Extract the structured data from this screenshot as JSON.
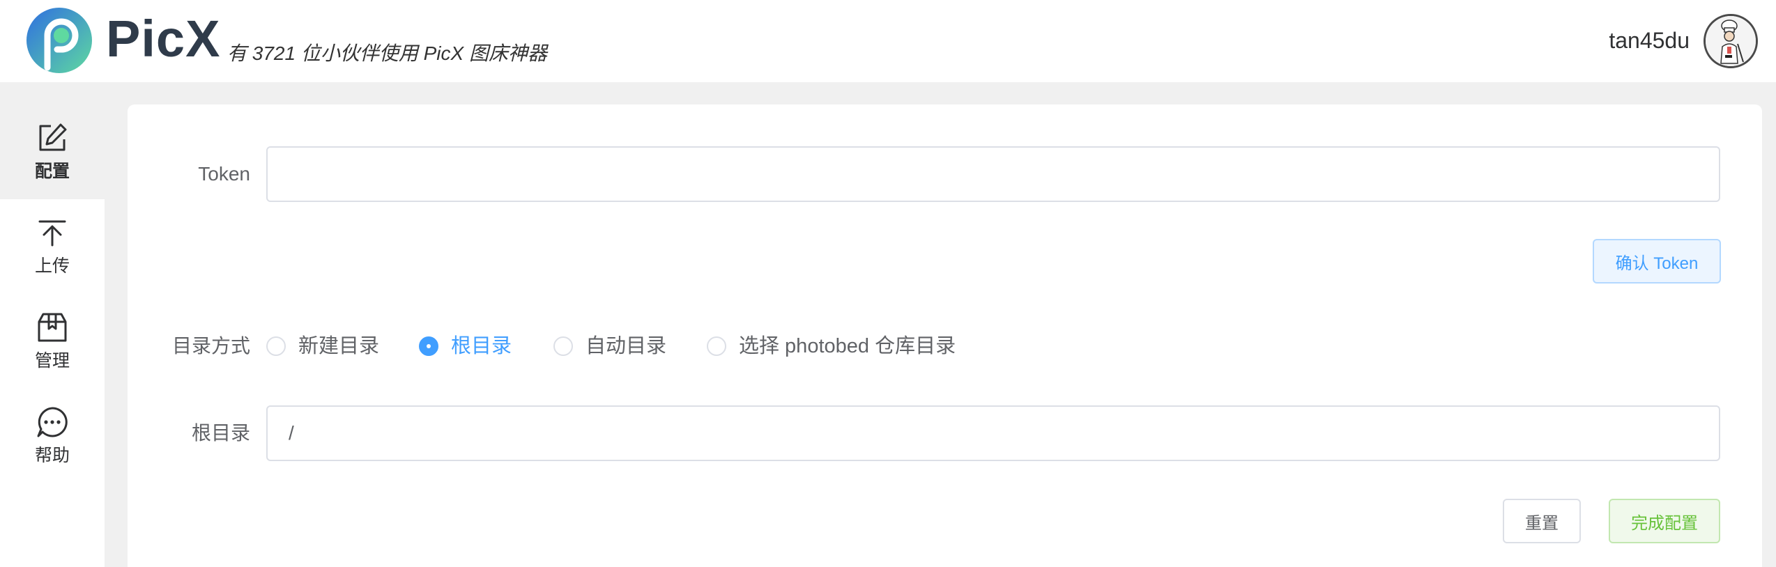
{
  "header": {
    "brand": "PicX",
    "tagline": "有 3721 位小伙伴使用 PicX 图床神器",
    "username": "tan45du"
  },
  "sidebar": {
    "items": [
      {
        "label": "配置",
        "icon": "edit-icon",
        "active": true
      },
      {
        "label": "上传",
        "icon": "upload-icon",
        "active": false
      },
      {
        "label": "管理",
        "icon": "box-icon",
        "active": false
      },
      {
        "label": "帮助",
        "icon": "chat-icon",
        "active": false
      }
    ]
  },
  "form": {
    "token_label": "Token",
    "token_value": "",
    "confirm_token_button": "确认 Token",
    "dir_mode_label": "目录方式",
    "dir_options": [
      {
        "label": "新建目录",
        "checked": false
      },
      {
        "label": "根目录",
        "checked": true
      },
      {
        "label": "自动目录",
        "checked": false
      },
      {
        "label": "选择 photobed 仓库目录",
        "checked": false
      }
    ],
    "root_dir_label": "根目录",
    "root_dir_value": "/",
    "reset_button": "重置",
    "finish_button": "完成配置"
  },
  "colors": {
    "primary": "#409eff",
    "success": "#67c23a",
    "brand_dark": "#2f3b4a",
    "logo_blue": "#3a8ee6",
    "logo_green": "#4fd1a5"
  }
}
